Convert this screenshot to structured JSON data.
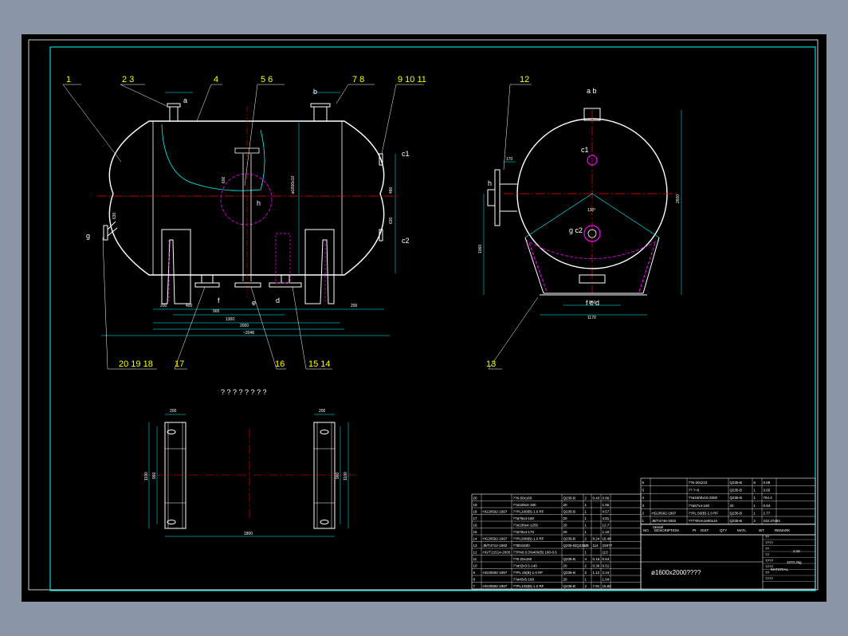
{
  "drawing": {
    "note_title": "? ? ? ? ? ? ? ?",
    "title_block_name": "ø1600x2000????",
    "colors": {
      "frame": "#00ffff",
      "vessel": "#ffffff",
      "center": "#ff0000",
      "hidden": "#ff00ff",
      "label": "#ffff00",
      "leader": "#00ffff"
    }
  },
  "part_labels": [
    {
      "id": "l1",
      "text": "1"
    },
    {
      "id": "l2",
      "text": "2 3"
    },
    {
      "id": "l4",
      "text": "4"
    },
    {
      "id": "l5",
      "text": "5 6"
    },
    {
      "id": "l7",
      "text": "7 8"
    },
    {
      "id": "l9",
      "text": "9 10 11"
    },
    {
      "id": "l12",
      "text": "12"
    },
    {
      "id": "l13",
      "text": "13"
    },
    {
      "id": "l14",
      "text": "15 14"
    },
    {
      "id": "l16",
      "text": "16"
    },
    {
      "id": "l17",
      "text": "17"
    },
    {
      "id": "l20",
      "text": "20 19 18"
    }
  ],
  "nozzle_labels": {
    "a": "a",
    "b": "b",
    "c1": "c1",
    "c2": "c2",
    "g": "g",
    "h": "h",
    "e": "e",
    "f": "f",
    "d": "d",
    "side_ab": "a b",
    "side_c1": "c1",
    "side_gc2": "g c2",
    "side_h": "h",
    "side_fcd": "f c d"
  },
  "dimensions": {
    "d200a": "200",
    "d200b": "200",
    "d400": "400",
    "d900": "900",
    "d1300": "1300",
    "d2000": "2000",
    "d3048": "~3048",
    "d2600": "2600",
    "d1600": "ø1600x10",
    "d480": "480",
    "d630": "630",
    "d600": "600",
    "d630b": "630",
    "d1170": "1170",
    "d860": "860",
    "d1060": "1060",
    "d130": "130°",
    "d170": "170",
    "s200a": "200",
    "s200b": "200",
    "s1190": "1190",
    "s960": "960",
    "s1800": "1800",
    "s1100": "1100",
    "s960b": "960"
  },
  "parts_list": [
    {
      "no": "20",
      "std": "",
      "name": "??6-50x160",
      "mat": "Q235-B",
      "qty": "2",
      "w1": "0.43",
      "w2": "0.86"
    },
    {
      "no": "19",
      "std": "",
      "name": "??ø108x4-160",
      "mat": "20",
      "qty": "1",
      "w1": "",
      "w2": "1.65"
    },
    {
      "no": "18",
      "std": "HG20592-1997",
      "name": "??PL100(B)-1.0 RF",
      "mat": "Q235-B",
      "qty": "1",
      "w1": "",
      "w2": "4.57"
    },
    {
      "no": "17",
      "std": "",
      "name": "??ø76x4-160",
      "mat": "20",
      "qty": "1",
      "w1": "",
      "w2": "3.81"
    },
    {
      "no": "16",
      "std": "",
      "name": "??ø108x4-1255",
      "mat": "20",
      "qty": "1",
      "w1": "",
      "w2": "12.7"
    },
    {
      "no": "15",
      "std": "",
      "name": "??ø76x4-170",
      "mat": "20",
      "qty": "1",
      "w1": "",
      "w2": "1.16"
    },
    {
      "no": "14",
      "std": "HG20592-1997",
      "name": "??PL200(B)-1.0 RF",
      "mat": "Q235-B",
      "qty": "2",
      "w1": "8.24",
      "w2": "16.48"
    },
    {
      "no": "13",
      "std": "JB/T4712-1992",
      "name": "??BN1600",
      "mat": "Q235-B/Q235-B",
      "qty": "2",
      "w1": "114",
      "w2": "228??"
    },
    {
      "no": "12",
      "std": "HG/T21514-2005",
      "name": "??PN0.6 DN400(B) 180-0.6",
      "mat": "",
      "qty": "1",
      "w1": "",
      "w2": "113"
    },
    {
      "no": "11",
      "std": "",
      "name": "??6-20x160",
      "mat": "Q235-B",
      "qty": "4",
      "w1": "0.16",
      "w2": "0.64"
    },
    {
      "no": "10",
      "std": "",
      "name": "??ø32x3.5-140",
      "mat": "20",
      "qty": "2",
      "w1": "0.36",
      "w2": "0.51"
    },
    {
      "no": "9",
      "std": "HG20592-1997",
      "name": "??PL 25(B)-1.0 RF",
      "mat": "Q235-B",
      "qty": "2",
      "w1": "1.12",
      "w2": "2.24"
    },
    {
      "no": "8",
      "std": "",
      "name": "??ø45x5-160",
      "mat": "20",
      "qty": "1",
      "w1": "",
      "w2": "1.04"
    },
    {
      "no": "7",
      "std": "HG20592-1997",
      "name": "??PL133(B)-1.0 RF",
      "mat": "Q235-B",
      "qty": "2",
      "w1": "7.91",
      "w2": "15.82"
    }
  ],
  "upper_list": [
    {
      "no": "6",
      "std": "",
      "name": "??6-20x210",
      "mat": "Q235-B",
      "qty": "6",
      "w": "0.69"
    },
    {
      "no": "5",
      "std": "",
      "name": "?? ?=6",
      "mat": "Q235-B",
      "qty": "1",
      "w": "3.65"
    },
    {
      "no": "4",
      "std": "",
      "name": "??ø1600x10-2000",
      "mat": "Q235-B",
      "qty": "1",
      "w": "794.4"
    },
    {
      "no": "3",
      "std": "",
      "name": "??ø57x4-160",
      "mat": "20",
      "qty": "1",
      "w": "0.84"
    },
    {
      "no": "2",
      "std": "HG20592-1997",
      "name": "??PL 50(B)-1.0 RF",
      "mat": "Q235-B",
      "qty": "1",
      "w": "2.77"
    },
    {
      "no": "1",
      "std": "JB/T4746-2002",
      "name": "????EHA1600x10",
      "mat": "Q235-B",
      "qty": "2",
      "w": "232.3?464"
    }
  ],
  "header_row": {
    "c1": "??",
    "c2": "?  ?  ? ?",
    "c3": "?  ?",
    "c4": "??",
    "c5": "??",
    "c6": "?  ?",
    "c7": "??"
  },
  "header_row_en": {
    "c1": "NO",
    "c2": "DESCRIPTION",
    "c3": "PI",
    "c4": "DIST",
    "c5": "QTY",
    "c6": "MATL",
    "c7": "WT",
    "c8": "REMARK"
  },
  "title_block": {
    "drawn": "Vessel",
    "scale": "1:10",
    "sheet": "1",
    "total": "1070.2kg",
    "mat_label": "MATERIAL",
    "rows": [
      "??",
      "????",
      "??",
      "??",
      "????",
      "????",
      "??",
      "????"
    ]
  }
}
